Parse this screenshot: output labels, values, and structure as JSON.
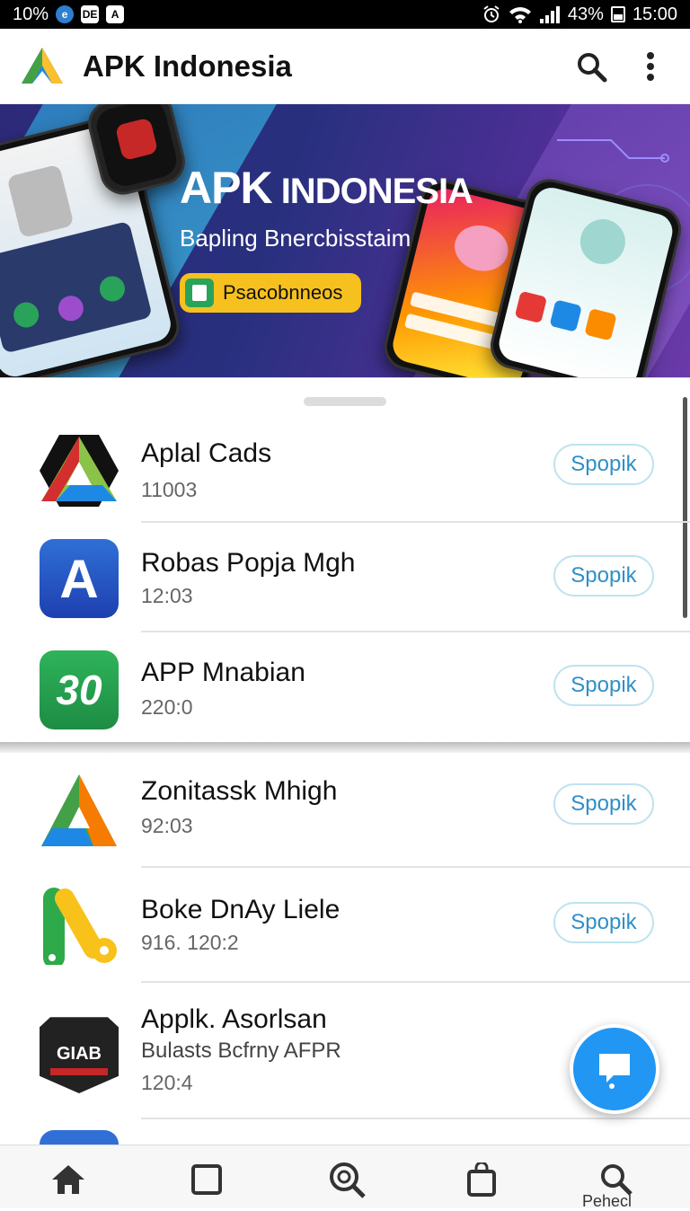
{
  "status_bar": {
    "left_text": "10%",
    "icon_a": "DE",
    "icon_b": "A",
    "battery_text": "43%",
    "time": "15:00",
    "icons": [
      "circle-app-icon",
      "doc-icon",
      "adobe-icon",
      "alarm-icon",
      "wifi-icon",
      "signal-icon",
      "battery-icon"
    ]
  },
  "app_bar": {
    "title": "APK Indonesia",
    "actions": [
      "search-icon",
      "more-vert-icon"
    ]
  },
  "banner": {
    "title_big": "APK",
    "title_small": " INDONESIA",
    "subtitle": "Bapling Bnercbisstaim",
    "button_label": "Psacobnneos"
  },
  "apps": [
    {
      "title": "Aplal Cads",
      "sub": "11003",
      "button": "Spopik",
      "icon": "tri-color-a-icon"
    },
    {
      "title": "Robas Popja Mgh",
      "sub": "12:03",
      "button": "Spopik",
      "icon": "blue-a-icon"
    },
    {
      "title": "APP Mnabian",
      "sub": "220:0",
      "button": "Spopik",
      "icon": "green-30-icon"
    },
    {
      "title": "Zonitassk Mhigh",
      "sub": "92:03",
      "button": "Spopik",
      "icon": "gradient-a-icon"
    },
    {
      "title": "Boke DnAy Liele",
      "sub": "916. 120:2",
      "button": "Spopik",
      "icon": "green-yellow-a-icon"
    },
    {
      "title": "Applk. Asorlsan",
      "sub2": "Bulasts Bcfrny AFPR",
      "sub": "120:4",
      "icon": "giab-shield-icon"
    }
  ],
  "colors": {
    "accent": "#2196f3",
    "button_text": "#2f8fc8",
    "banner_yellow": "#f6c01e"
  },
  "bottom_nav": {
    "items": [
      "home-icon",
      "square-icon",
      "search-circle-icon",
      "bag-icon",
      "search-icon"
    ],
    "last_label": "Pehecl"
  }
}
